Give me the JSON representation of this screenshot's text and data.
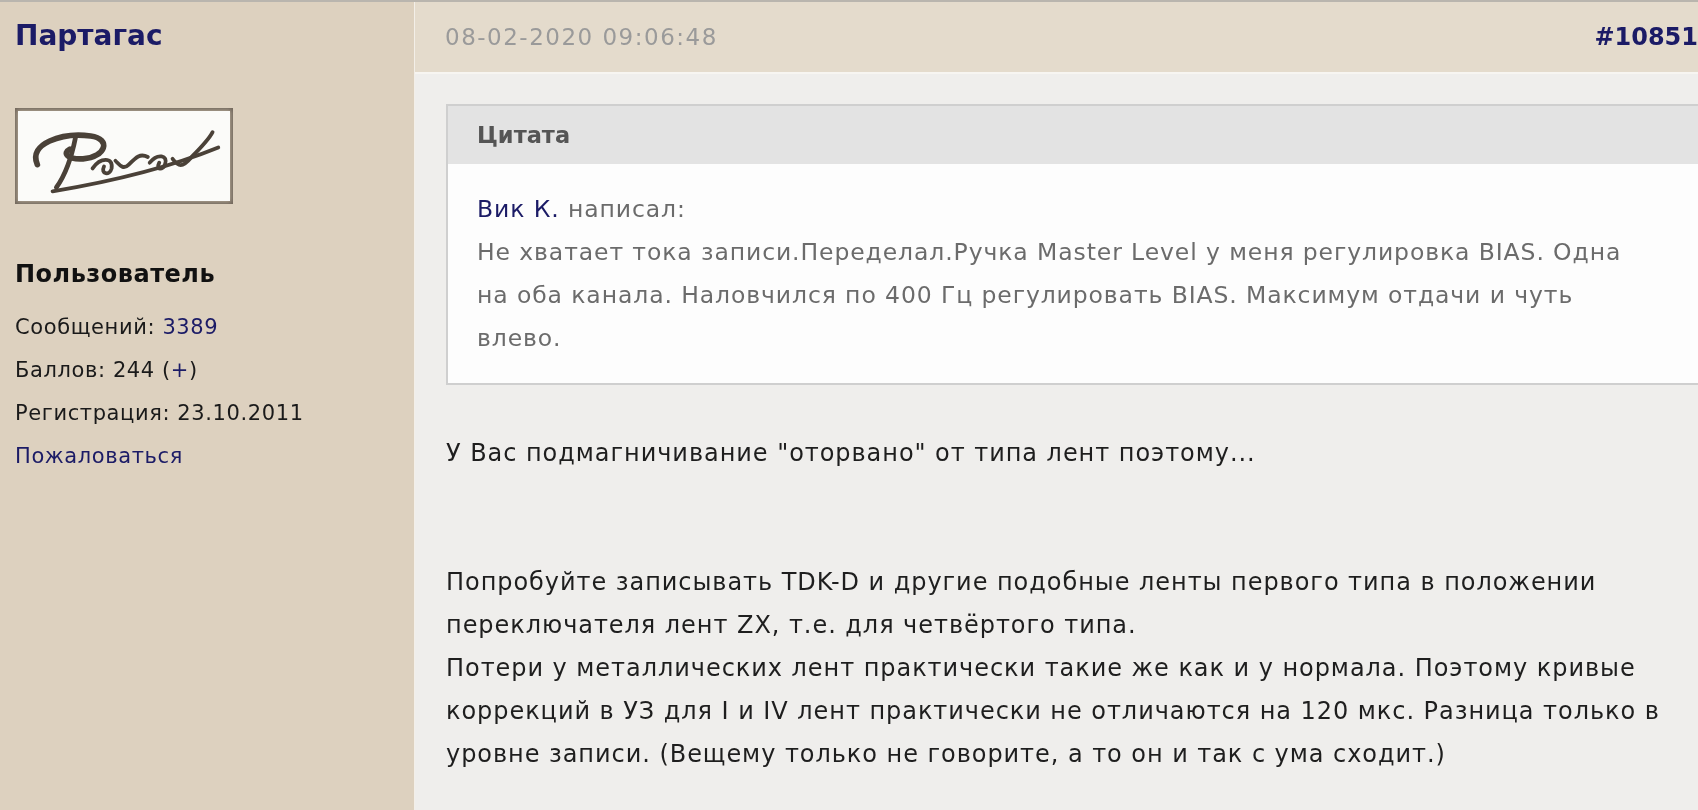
{
  "author": {
    "name": "Партагас",
    "rank": "Пользователь",
    "stats": [
      {
        "parts": [
          {
            "text": "Сообщений: ",
            "link": false
          },
          {
            "text": "3389",
            "link": true
          }
        ]
      },
      {
        "parts": [
          {
            "text": "Баллов: 244 (",
            "link": false
          },
          {
            "text": "+",
            "link": true
          },
          {
            "text": ")",
            "link": false
          }
        ]
      },
      {
        "parts": [
          {
            "text": "Регистрация: 23.10.2011",
            "link": false
          }
        ]
      }
    ],
    "report_link": "Пожаловаться"
  },
  "post": {
    "date": "08-02-2020 09:06:48",
    "number": "#10851",
    "quote": {
      "title": "Цитата",
      "author": "Вик К.",
      "wrote": "написал:",
      "text": "Не хватает тока записи.Переделал.Ручка Master Level у меня регулировка BIAS. Одна на оба канала. Наловчился по 400 Гц регулировать BIAS. Максимум отдачи и чуть влево."
    },
    "paragraphs": [
      "У Вас подмагничивание \"оторвано\" от типа лент поэтому...",
      "Попробуйте записывать TDK-D и другие подобные ленты первого типа в положении переключателя лент ZX, т.е. для четвёртого типа.",
      "Потери у металлических лент практически такие же как и у нормала. Поэтому кривые коррекций в УЗ для I и IV лент практически не отличаются на 120 мкс. Разница только в уровне записи. (Вещему только не говорите, а то он и так с ума сходит.)"
    ]
  }
}
